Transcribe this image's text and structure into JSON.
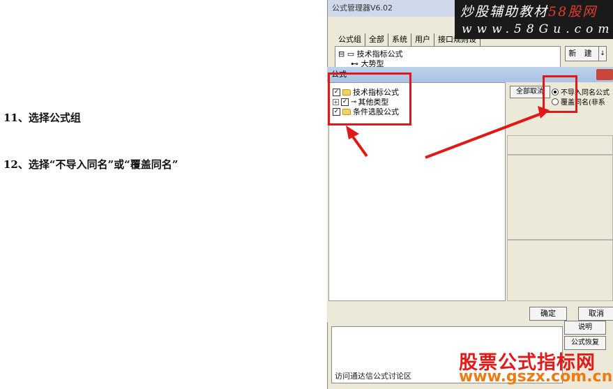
{
  "instructions": [
    {
      "text": "11、选择公式组"
    },
    {
      "text": "12、选择“不导入同名”或“覆盖同名”"
    }
  ],
  "background_window": {
    "title": "公式管理器V6.02",
    "tabs": [
      "公式组",
      "全部",
      "系统",
      "用户",
      "接口规则设"
    ],
    "tree": [
      "技术指标公式",
      "大势型"
    ],
    "new_button": "新 建",
    "new_button_arrow": "↓"
  },
  "logo": {
    "line1_a": "炒股辅助教材",
    "line1_b": "58股网",
    "line2": "www.58Gu.com"
  },
  "dialog": {
    "title": "公式",
    "tree": [
      {
        "label": "技术指标公式",
        "checked": true
      },
      {
        "label": "其他类型",
        "checked": true
      },
      {
        "label": "条件选股公式",
        "checked": true
      }
    ],
    "select_all_button": "全部取消",
    "radio_options": [
      {
        "label": "不导入同名公式",
        "selected": true
      },
      {
        "label": "覆盖同名(非系",
        "selected": false
      }
    ],
    "ok_button": "确定",
    "cancel_button": "取消"
  },
  "side_buttons": [
    "说明",
    "公式恢复"
  ],
  "footer_link": "访问通达信公式讨论区",
  "watermark": {
    "line1": "股票公式指标网",
    "line2": "www.gszx.com.cn"
  },
  "colors": {
    "highlight": "#e01818",
    "watermark_red": "#e21a1a",
    "watermark_orange": "#f07a12"
  }
}
